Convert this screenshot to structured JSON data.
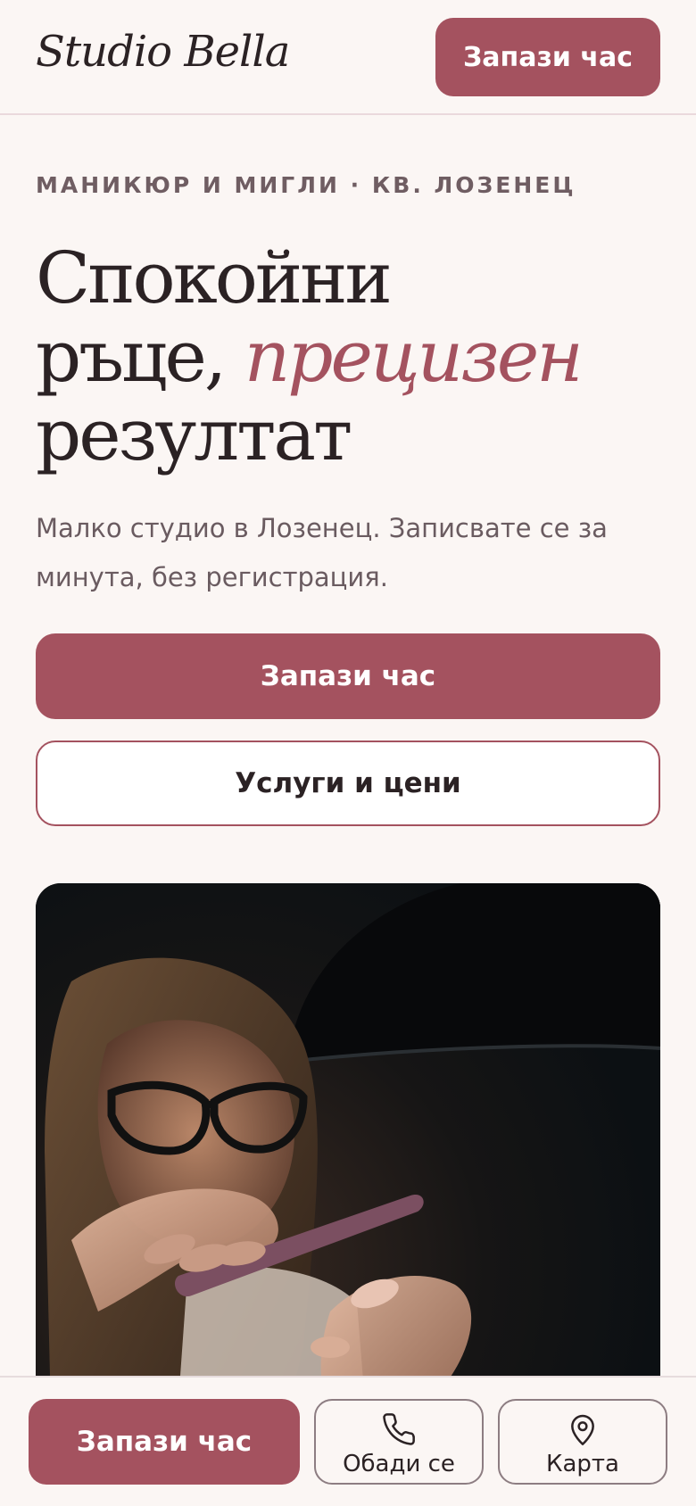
{
  "header": {
    "logo": "Studio Bella",
    "cta_label": "Запази час"
  },
  "hero": {
    "eyebrow": "МАНИКЮР И МИГЛИ · КВ. ЛОЗЕНЕЦ",
    "title_line1": "Спокойни",
    "title_line2_plain": "ръце, ",
    "title_line2_accent": "прецизен",
    "title_line3": "резултат",
    "subtitle": "Малко студио в Лозенец. Записвате се за минута, без регистрация.",
    "primary_button": "Запази час",
    "secondary_button": "Услуги и цени"
  },
  "bottom_bar": {
    "book_label": "Запази час",
    "call_label": "Обади се",
    "call_icon": "phone-icon",
    "map_label": "Карта",
    "map_icon": "map-pin-icon"
  },
  "colors": {
    "accent": "#a4525f",
    "background": "#fbf6f4",
    "text": "#2b2224",
    "muted": "#6a5b60"
  }
}
